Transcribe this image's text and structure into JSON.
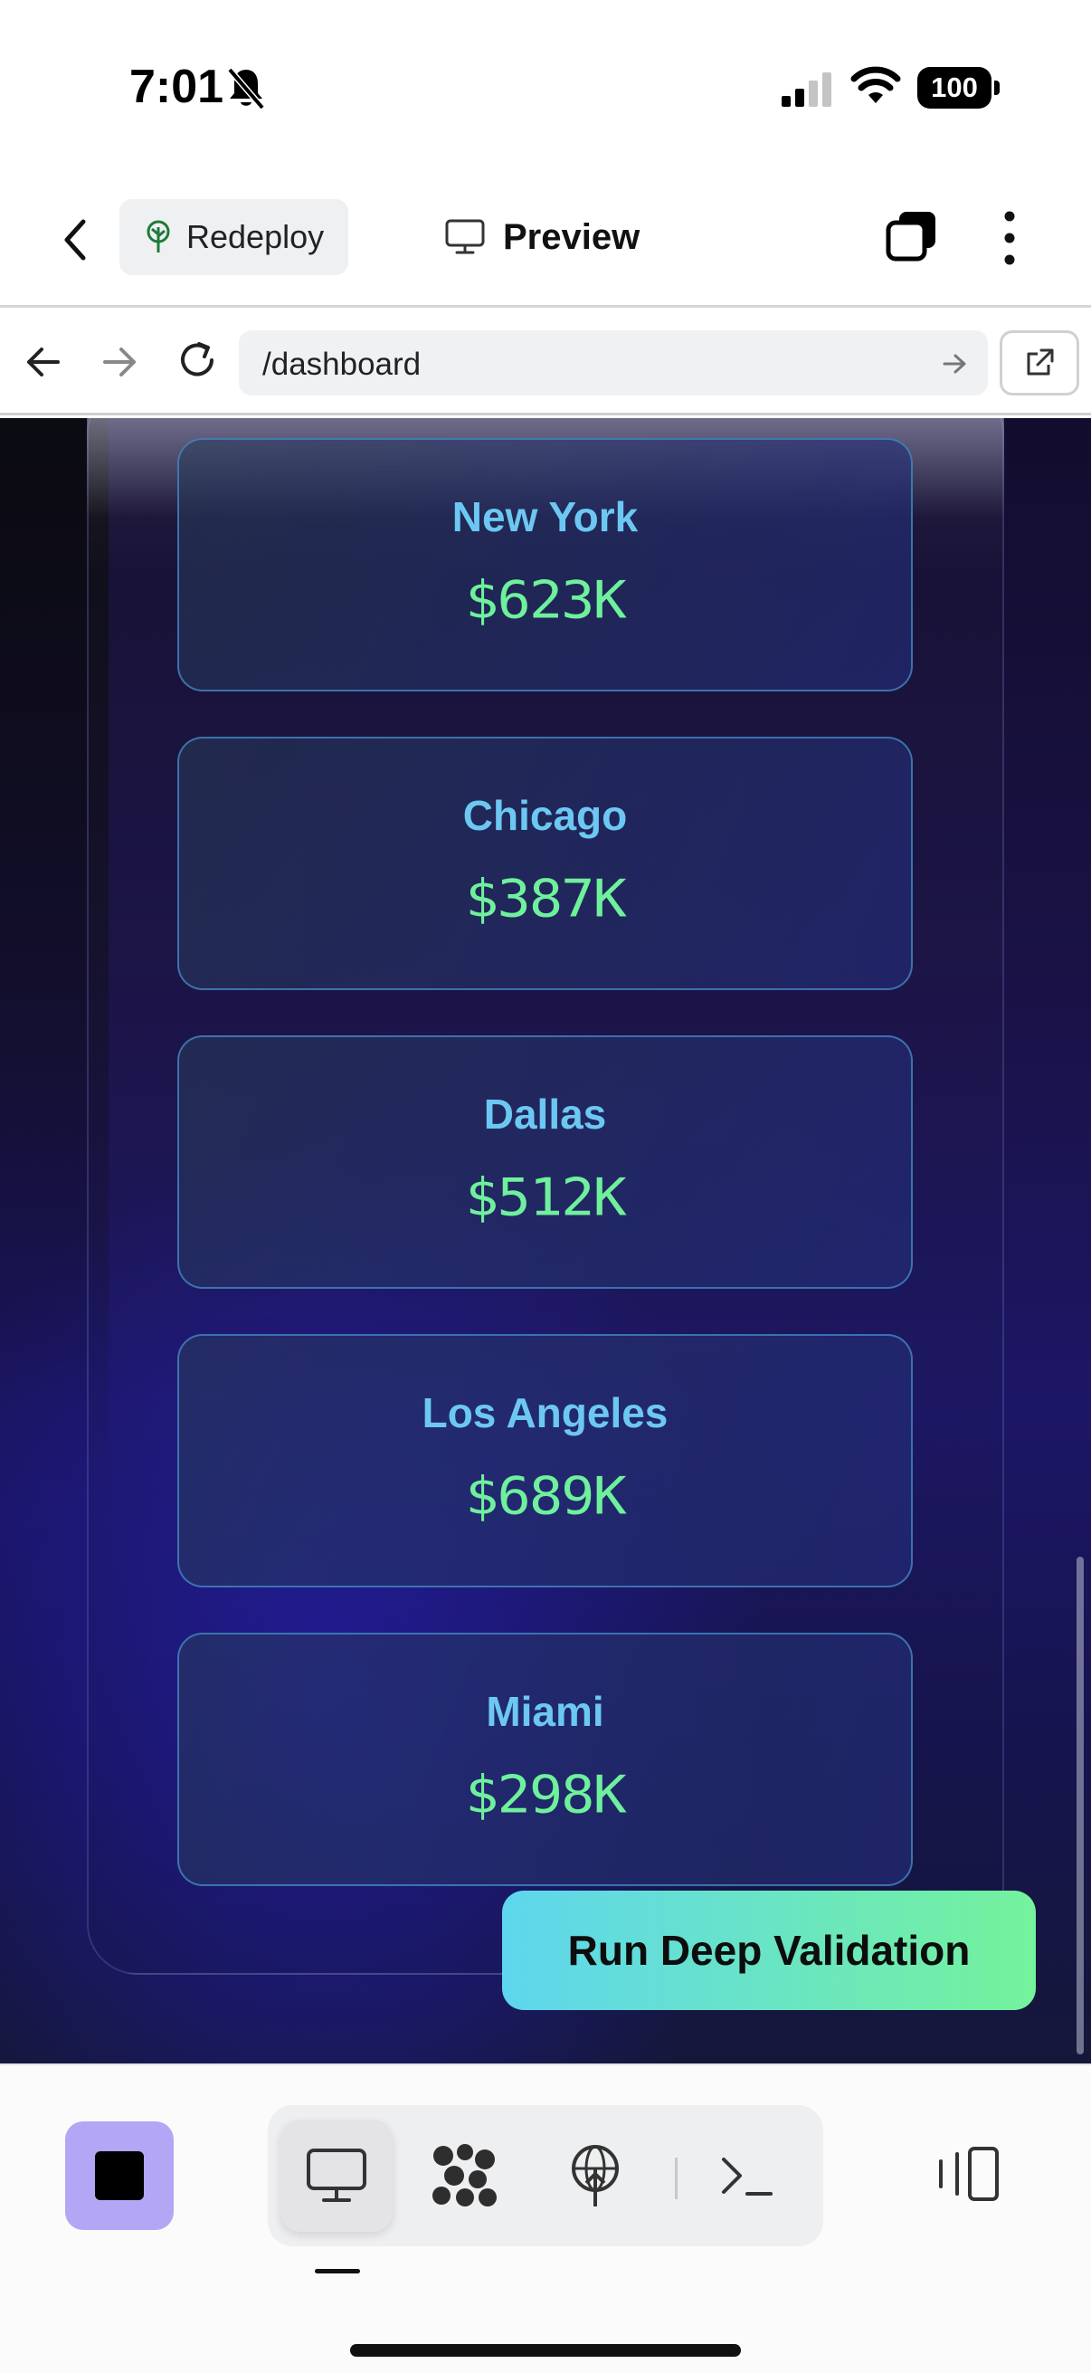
{
  "status_bar": {
    "time": "7:01",
    "battery": "100",
    "icons": [
      "bell-slash-icon",
      "signal-icon",
      "wifi-icon",
      "battery-icon"
    ]
  },
  "app_header": {
    "back_icon": "chevron-left-icon",
    "redeploy_label": "Redeploy",
    "redeploy_icon": "tree-icon",
    "preview_label": "Preview",
    "preview_icon": "monitor-icon",
    "layers_icon": "layers-icon",
    "more_icon": "more-vertical-icon"
  },
  "browser": {
    "url": "/dashboard",
    "icons": [
      "arrow-left-icon",
      "arrow-right-icon",
      "reload-icon",
      "arrow-right-icon",
      "external-link-icon"
    ]
  },
  "dashboard": {
    "cities": [
      {
        "name": "New York",
        "value": "$623K"
      },
      {
        "name": "Chicago",
        "value": "$387K"
      },
      {
        "name": "Dallas",
        "value": "$512K"
      },
      {
        "name": "Los Angeles",
        "value": "$689K"
      },
      {
        "name": "Miami",
        "value": "$298K"
      }
    ],
    "action_button": "Run Deep Validation",
    "colors": {
      "city_name": "#6cc8f2",
      "city_value": "#6ff09c",
      "button_gradient_start": "#5ed6ee",
      "button_gradient_end": "#74f29b"
    }
  },
  "bottom_toolbar": {
    "stop_color": "#b3a6f4",
    "tools": [
      "monitor-icon",
      "cluster-icon",
      "deploy-globe-icon",
      "terminal-icon"
    ],
    "active_tool": "monitor-icon",
    "panel_toggle_icon": "panel-toggle-icon"
  }
}
